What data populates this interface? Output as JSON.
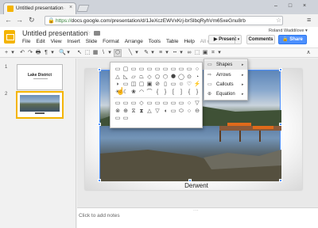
{
  "browser": {
    "tab_title": "Untitled presentation - Go",
    "tab_close": "×",
    "window_buttons": [
      "–",
      "□",
      "×"
    ],
    "nav": {
      "back": "←",
      "forward": "→",
      "reload": "↻"
    },
    "url_scheme": "https://",
    "url_rest": "docs.google.com/presentation/d/1JeXczEWVxKrj-brSlbqRyhVm65xeGnu8rb",
    "menu_glyph": "≡"
  },
  "docs": {
    "title": "Untitled presentation",
    "menu": [
      "File",
      "Edit",
      "View",
      "Insert",
      "Slide",
      "Format",
      "Arrange",
      "Tools",
      "Table",
      "Help",
      "All cha..."
    ],
    "user": "Roland Waddilove ▾",
    "present_label": "Present",
    "comments_label": "Comments",
    "share_label": "Share"
  },
  "toolbar": {
    "icons": [
      "+",
      "▾",
      "↶",
      "↷",
      "🖶",
      "¶",
      "▾",
      "🔍",
      "▾",
      "↖",
      "⬚",
      "▦",
      "\\",
      "▾",
      "⬡",
      "╲",
      "▾",
      "✎",
      "▾",
      "≡",
      "▾",
      "┅",
      "▾",
      "∞",
      "⬚",
      "▣",
      "⌗",
      "▾",
      "∧"
    ]
  },
  "filmstrip": {
    "slides": [
      {
        "number": "1",
        "title": "Lake District"
      },
      {
        "number": "2"
      }
    ]
  },
  "slide": {
    "caption": "Derwent"
  },
  "notes": {
    "placeholder": "Click to add notes",
    "grip": "····"
  },
  "shape_menu": {
    "items": [
      {
        "label": "Shapes",
        "icon": "▭",
        "arrow": "▸",
        "active": true
      },
      {
        "label": "Arrows",
        "icon": "⇨",
        "arrow": "▸",
        "active": false
      },
      {
        "label": "Callouts",
        "icon": "▭",
        "arrow": "▸",
        "active": false
      },
      {
        "label": "Equation",
        "icon": "⊕",
        "arrow": "▸",
        "active": false
      }
    ]
  },
  "shape_palette": {
    "rows": [
      [
        "▭",
        "▢",
        "▭",
        "▭",
        "▭",
        "▭",
        "▭",
        "▭",
        "▭",
        "▭"
      ],
      [
        "○",
        "△",
        "◺",
        "▱",
        "⏢",
        "◇",
        "⬠",
        "⬡",
        "⯃",
        "◯"
      ],
      [
        "⊙",
        "◔",
        "◗",
        "▭",
        "◫",
        "▢",
        "▣",
        "⊘",
        "▯",
        "▭"
      ],
      [
        "☺",
        "♡",
        "⚡",
        "☀",
        "☾",
        "❀",
        "◠",
        "⌒",
        "{",
        "}"
      ],
      [
        "[",
        "]",
        "{",
        "}"
      ],
      [
        "▭",
        "▭",
        "▭",
        "◇",
        "▭",
        "▭",
        "▭",
        "▭",
        "▭",
        "○"
      ],
      [
        "▽",
        "⊗",
        "⊕",
        "⧖",
        "⧗",
        "△",
        "▽",
        "◖",
        "▭",
        "⬭"
      ],
      [
        "○",
        "⊖",
        "▭",
        "▭"
      ]
    ],
    "cursor": "☝"
  },
  "colors": {
    "chrome_bg": "#cfd3da",
    "share_blue": "#4d90fe",
    "docs_logo": "#f4b400",
    "selection": "#4d90fe"
  }
}
